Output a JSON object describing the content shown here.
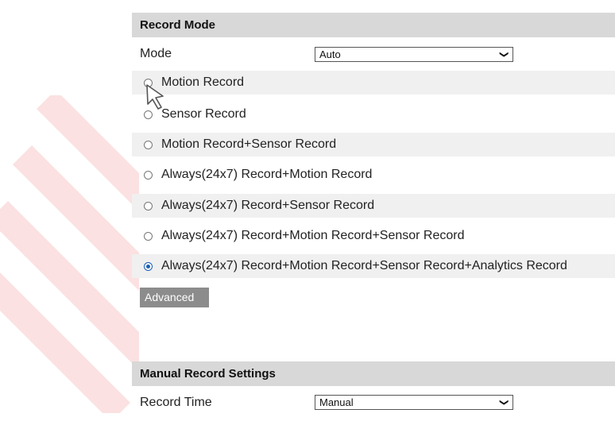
{
  "record_mode": {
    "title": "Record Mode",
    "mode_label": "Mode",
    "mode_value": "Auto",
    "options": [
      {
        "label": "Motion Record",
        "checked": false
      },
      {
        "label": "Sensor Record",
        "checked": false
      },
      {
        "label": "Motion Record+Sensor Record",
        "checked": false
      },
      {
        "label": "Always(24x7) Record+Motion Record",
        "checked": false
      },
      {
        "label": "Always(24x7) Record+Sensor Record",
        "checked": false
      },
      {
        "label": "Always(24x7) Record+Motion Record+Sensor Record",
        "checked": false
      },
      {
        "label": "Always(24x7) Record+Motion Record+Sensor Record+Analytics Record",
        "checked": true
      }
    ],
    "advanced_label": "Advanced"
  },
  "manual": {
    "title": "Manual Record Settings",
    "time_label": "Record Time",
    "time_value": "Manual"
  },
  "colors": {
    "header_bg": "#d8d8d8",
    "row_shade": "#f0f0f0",
    "button_bg": "#8c8c8c",
    "radio_accent": "#1a5fb4",
    "watermark": "#e64646"
  },
  "icons": {
    "select_arrow": "chevron-down-icon",
    "pointer": "hand-pointer-icon"
  }
}
